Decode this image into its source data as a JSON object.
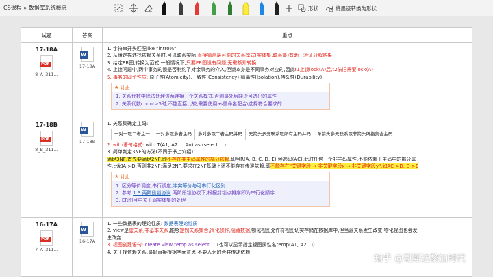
{
  "toolbar": {
    "breadcrumb": "CS课程 » 数据库系统概念",
    "shape_label": "形状",
    "ink_to_shape_label": "将墨迹转换为形状",
    "pen_colors": [
      "#111111",
      "#3c3c3c",
      "#e53935",
      "#43a047",
      "#2e7d32",
      "#ffeb3b",
      "#1e88e5",
      "#212121"
    ]
  },
  "table": {
    "headers": {
      "question": "试题",
      "answer": "答案",
      "focus": "重点"
    },
    "rows": [
      {
        "id": "17-18A",
        "pdf_label": "PDF",
        "pdf_file": "8_A_311...",
        "word_label": "W",
        "word_file": "17-18A",
        "l1": "1. 字符串开头匹配like \"intro%\"",
        "l2a": "2. 从给定描述找依赖关系时,可以联系实际,",
        "l2b": "直接猜测最可能的关系模式(实体集,联系集)有助于验证分解结果",
        "l3a": "3. 给定ER图,转换为范式,一般情况下,",
        "l3b": "只要ER图没有问题,无需额外转换",
        "l4a": "4. 上锁问题中,两个事务的锁是否制约了对余事务的介入,但锁本身是不同事务对应的,因此",
        "l4b": "t1上锁lock(A)后,t2依旧需要lock(A)",
        "l5a": "5. 事务的四个性质:",
        "l5b": " 原子性(Atomicity),一致性(Consistency),隔离性(Isolation),持久性(Durability)",
        "tip_title": "订正",
        "tip1": "1. 关系代数中除法处理该两连接一个关系模式,否则最外层缺少可选出的属性",
        "tip2": "2. 关系代数count>5时,不能直接比较,需要使用as重命名配合\\选择符合要求的"
      },
      {
        "id": "17-18B",
        "pdf_label": "PDF",
        "pdf_file": "8_B_311...",
        "word_label": "W",
        "word_file": "17-18B",
        "l1": "1. 关系集确定主码:",
        "mini": [
          "一对一取二者之一",
          "一对多取多者主码",
          "多对多取二者主码并码",
          "无箭头多元联系取所有主码并码",
          "单箭头多元联系取非箭头所指集合主码"
        ],
        "l2a": "2. with语句格式:",
        "l2b": " with T(A1, A2 ... An) as (select ...)",
        "l3": "3. 简单判定3NF的方法(不同于书上介绍):",
        "l4a": "满足3NF,首先要满足2NF,即",
        "l4b": "不存在非主码属性的部分依赖",
        "l4c": ",即当R(A, B, C, D, E),候选码(AC),此时任何一个非主码属性,不能依赖于主码中的部分属",
        "l5": "性,比如A->D,否则非2NF;满足2NF,要求在2NF基础上还不能存在传递依赖,即",
        "l5b": "不能存在\"关键字段 → 非关键字段x → 非关键字段y\",如AC->D, D->E",
        "tip_title": "订正",
        "tip1": "1. 区分等价调度,串行调度,",
        "tip1b": "冲突等价与可串行化区别",
        "tip2a": "2. 参考 ",
        "tip2b": "1.3 两阶段锁协议",
        "tip2c": " 两阶段锁协议下,根据封锁点排序即为串行化顺序",
        "tip3": "3. ER图目中关于弱实体集的处理"
      },
      {
        "id": "16-17A",
        "pdf_label": "PDF",
        "pdf_file": "7_A_311...",
        "word_label": "W",
        "word_file": "16-17A",
        "l1a": "1. 一些数据表的理论性质: ",
        "l1b": "数据表理论性质",
        "l2a": "2. view是",
        "l2b": "虚关系,非基本关系",
        "l2c": ",能够",
        "l2d": "定制关系集合,简化操作,隐藏数据",
        "l2e": ",物化视图允许将视图切实存储在数据库中,但当源关系发生改变,物化视图也会发",
        "l2f": "生改变",
        "l3a": "3. 视图创建语句:",
        "l3b": " create view temp as select ...",
        "l3c": " (也可以显示指定视图属性名temp(A1, A2...))",
        "l4": "4. 关于找依赖关系,最好直接根据字面意思,不要人为的合并传递依赖"
      }
    ]
  },
  "watermark": "知乎 @哥斯达黎加时代"
}
